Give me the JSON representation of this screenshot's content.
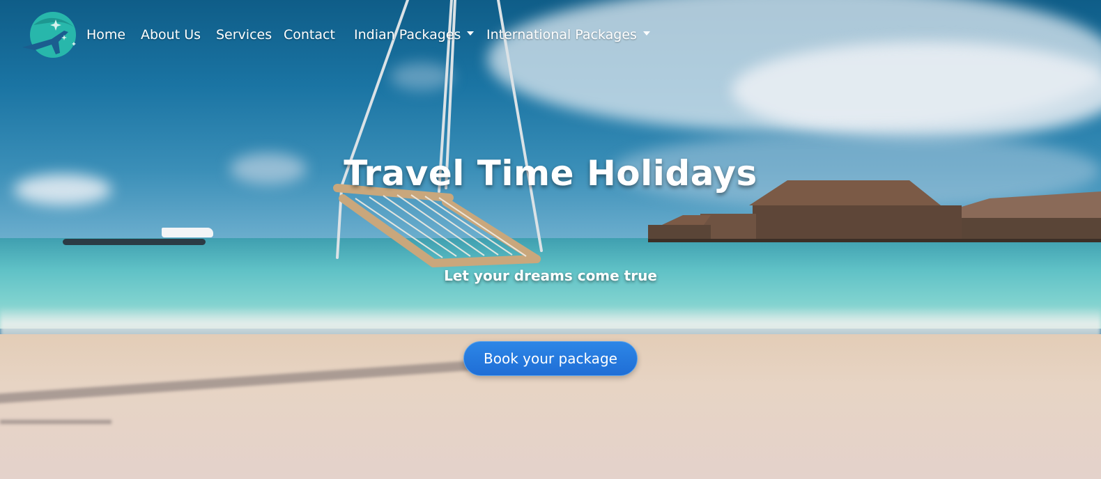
{
  "nav": {
    "items": [
      {
        "label": "Home"
      },
      {
        "label": "About Us"
      },
      {
        "label": "Services"
      },
      {
        "label": "Contact"
      },
      {
        "label": "Indian Packages",
        "dropdown": true
      },
      {
        "label": "International Packages",
        "dropdown": true
      }
    ],
    "logo_icon": "globe-plane-icon"
  },
  "hero": {
    "title": "Travel Time Holidays",
    "subtitle": "Let your dreams come true",
    "cta_label": "Book your package"
  },
  "colors": {
    "accent": "#1f6ed6",
    "logo": "#2cc2b0",
    "text": "#ffffff"
  }
}
